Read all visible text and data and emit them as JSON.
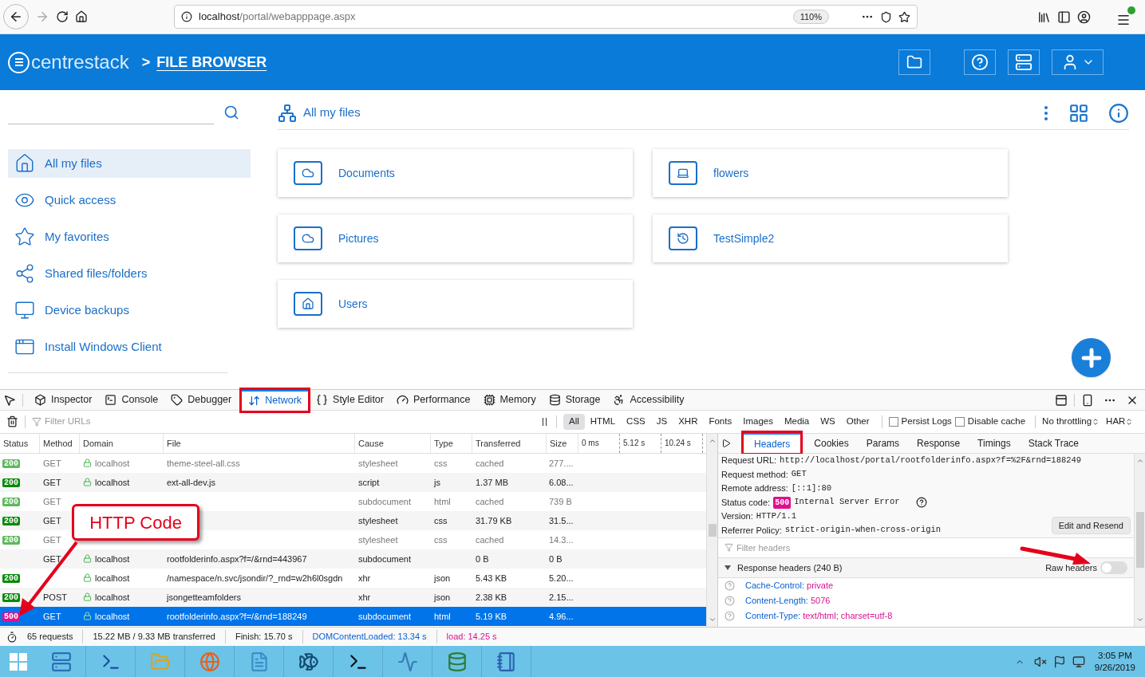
{
  "browser": {
    "url_host": "localhost",
    "url_path": "/portal/webapppage.aspx",
    "zoom": "110%"
  },
  "header": {
    "brand": "centrestack",
    "separator": ">",
    "title": "FILE BROWSER"
  },
  "sidebar": {
    "items": [
      {
        "label": "All my files",
        "selected": true
      },
      {
        "label": "Quick access",
        "selected": false
      },
      {
        "label": "My favorites",
        "selected": false
      },
      {
        "label": "Shared files/folders",
        "selected": false
      },
      {
        "label": "Device backups",
        "selected": false
      },
      {
        "label": "Install Windows Client",
        "selected": false
      }
    ]
  },
  "breadcrumb": "All my files",
  "folders": [
    {
      "name": "Documents"
    },
    {
      "name": "flowers"
    },
    {
      "name": "Pictures"
    },
    {
      "name": "TestSimple2"
    },
    {
      "name": "Users"
    }
  ],
  "devtools": {
    "tools": [
      {
        "label": "Inspector",
        "selected": false,
        "highlighted": false
      },
      {
        "label": "Console",
        "selected": false,
        "highlighted": false
      },
      {
        "label": "Debugger",
        "selected": false,
        "highlighted": false
      },
      {
        "label": "Network",
        "selected": true,
        "highlighted": true
      },
      {
        "label": "Style Editor",
        "selected": false,
        "highlighted": false
      },
      {
        "label": "Performance",
        "selected": false,
        "highlighted": false
      },
      {
        "label": "Memory",
        "selected": false,
        "highlighted": false
      },
      {
        "label": "Storage",
        "selected": false,
        "highlighted": false
      },
      {
        "label": "Accessibility",
        "selected": false,
        "highlighted": false
      }
    ],
    "filter": {
      "placeholder": "Filter URLs"
    },
    "types": [
      {
        "label": "All",
        "selected": true
      },
      {
        "label": "HTML",
        "selected": false
      },
      {
        "label": "CSS",
        "selected": false
      },
      {
        "label": "JS",
        "selected": false
      },
      {
        "label": "XHR",
        "selected": false
      },
      {
        "label": "Fonts",
        "selected": false
      },
      {
        "label": "Images",
        "selected": false
      },
      {
        "label": "Media",
        "selected": false
      },
      {
        "label": "WS",
        "selected": false
      },
      {
        "label": "Other",
        "selected": false
      }
    ],
    "options": [
      {
        "label": "Persist Logs",
        "checked": false
      },
      {
        "label": "Disable cache",
        "checked": false
      }
    ],
    "throttling": "No throttling",
    "har": "HAR"
  },
  "table": {
    "columns": [
      "Status",
      "Method",
      "Domain",
      "File",
      "Cause",
      "Type",
      "Transferred",
      "Size"
    ],
    "timeline": [
      "0 ms",
      "5.12 s",
      "10.24 s"
    ],
    "rows": [
      {
        "status": "200",
        "kind": "success",
        "method": "GET",
        "domain": "localhost",
        "file": "theme-steel-all.css",
        "cause": "stylesheet",
        "type": "css",
        "transferred": "cached",
        "size": "277....",
        "dim": true,
        "selected": false
      },
      {
        "status": "200",
        "kind": "success",
        "method": "GET",
        "domain": "localhost",
        "file": "ext-all-dev.js",
        "cause": "script",
        "type": "js",
        "transferred": "1.37 MB",
        "size": "6.08...",
        "dim": false,
        "selected": false
      },
      {
        "status": "200",
        "kind": "success",
        "method": "GET",
        "cause": "subdocument",
        "type": "html",
        "transferred": "cached",
        "size": "739 B",
        "dim": true,
        "selected": false
      },
      {
        "status": "200",
        "kind": "success",
        "method": "GET",
        "cause": "stylesheet",
        "type": "css",
        "transferred": "31.79 KB",
        "size": "31.5...",
        "dim": false,
        "selected": false
      },
      {
        "status": "200",
        "kind": "success",
        "method": "GET",
        "cause": "stylesheet",
        "type": "css",
        "transferred": "cached",
        "size": "14.3...",
        "dim": true,
        "selected": false
      },
      {
        "method": "GET",
        "domain": "localhost",
        "file": "rootfolderinfo.aspx?f=/&rnd=443967",
        "cause": "subdocument",
        "transferred": "0 B",
        "size": "0 B",
        "dim": false,
        "selected": false
      },
      {
        "status": "200",
        "kind": "success",
        "domain": "localhost",
        "file": "/namespace/n.svc/jsondir/?_rnd=w2h6l0sgdn",
        "cause": "xhr",
        "type": "json",
        "transferred": "5.43 KB",
        "size": "5.20...",
        "dim": false,
        "selected": false
      },
      {
        "status": "200",
        "kind": "success",
        "method": "POST",
        "domain": "localhost",
        "file": "jsongetteamfolders",
        "cause": "xhr",
        "type": "json",
        "transferred": "2.38 KB",
        "size": "2.15...",
        "dim": false,
        "selected": false
      },
      {
        "status": "500",
        "kind": "error",
        "method": "GET",
        "domain": "localhost",
        "file": "rootfolderinfo.aspx?f=/&rnd=188249",
        "cause": "subdocument",
        "type": "html",
        "transferred": "5.19 KB",
        "size": "4.96...",
        "dim": false,
        "selected": true
      }
    ]
  },
  "summary": {
    "requests": "65 requests",
    "transferred": "15.22 MB / 9.33 MB transferred",
    "finish": "Finish: 15.70 s",
    "dom": "DOMContentLoaded: 13.34 s",
    "load": "load: 14.25 s"
  },
  "details": {
    "tabs": [
      {
        "label": "Headers",
        "selected": true,
        "highlighted": true
      },
      {
        "label": "Cookies",
        "selected": false,
        "highlighted": false
      },
      {
        "label": "Params",
        "selected": false,
        "highlighted": false
      },
      {
        "label": "Response",
        "selected": false,
        "highlighted": false
      },
      {
        "label": "Timings",
        "selected": false,
        "highlighted": false
      },
      {
        "label": "Stack Trace",
        "selected": false,
        "highlighted": false
      }
    ],
    "fields": [
      {
        "label": "Request URL:",
        "value": "http://localhost/portal/rootfolderinfo.aspx?f=%2F&rnd=188249"
      },
      {
        "label": "Request method:",
        "value": "GET"
      },
      {
        "label": "Remote address:",
        "value": "[::1]:80"
      },
      {
        "label": "Status code:",
        "badge": "500",
        "value": "Internal Server Error"
      },
      {
        "label": "Version:",
        "value": "HTTP/1.1"
      },
      {
        "label": "Referrer Policy:",
        "value": "strict-origin-when-cross-origin"
      }
    ],
    "resend": "Edit and Resend",
    "filter": {
      "placeholder": "Filter headers"
    },
    "section": {
      "title": "Response headers (240 B)",
      "expanded": true
    },
    "raw": {
      "label": "Raw headers",
      "on": false
    },
    "headers": [
      {
        "name": "Cache-Control:",
        "value": "private"
      },
      {
        "name": "Content-Length:",
        "value": "5076"
      },
      {
        "name": "Content-Type:",
        "value": "text/html; charset=utf-8"
      }
    ]
  },
  "annotation": {
    "callout": "HTTP Code"
  },
  "taskbar": {
    "time": "3:05 PM",
    "date": "9/26/2019"
  }
}
